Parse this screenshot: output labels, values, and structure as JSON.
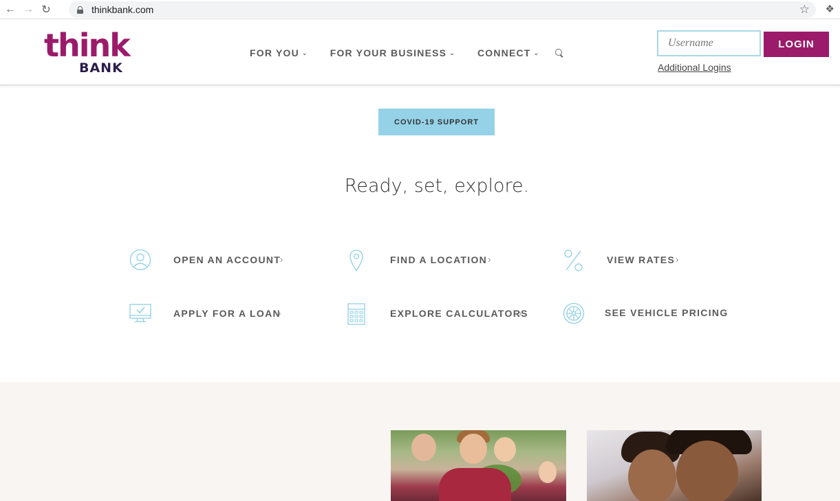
{
  "browser": {
    "url": "thinkbank.com"
  },
  "logo": {
    "word1": "think",
    "word2": "BANK",
    "colors": {
      "primary": "#9b1b6a",
      "secondary": "#2b1b4b"
    }
  },
  "nav": {
    "items": [
      {
        "label": "FOR YOU"
      },
      {
        "label": "FOR YOUR BUSINESS"
      },
      {
        "label": "CONNECT"
      }
    ]
  },
  "login": {
    "username_placeholder": "Username",
    "username_value": "",
    "button_label": "LOGIN",
    "additional_logins": "Additional Logins"
  },
  "banner": {
    "covid_label": "COVID-19 SUPPORT"
  },
  "headline": "Ready, set, explore.",
  "quick_links": [
    {
      "label": "OPEN AN ACCOUNT",
      "icon": "user-circle-icon"
    },
    {
      "label": "FIND A LOCATION",
      "icon": "map-pin-icon"
    },
    {
      "label": "VIEW RATES",
      "icon": "percent-icon"
    },
    {
      "label": "APPLY FOR A LOAN",
      "icon": "monitor-check-icon"
    },
    {
      "label": "EXPLORE CALCULATORS",
      "icon": "calculator-icon"
    },
    {
      "label": "SEE VEHICLE PRICING",
      "icon": "wheel-icon"
    }
  ],
  "accent_color": "#95d2e8"
}
